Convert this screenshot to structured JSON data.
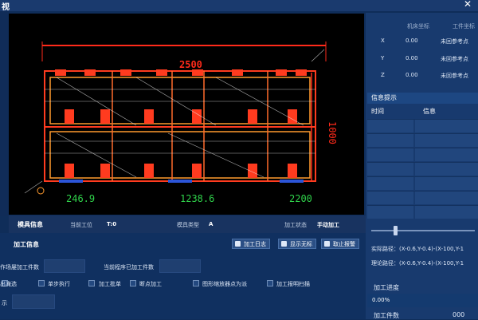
{
  "window": {
    "title": "视",
    "close_glyph": "✕"
  },
  "coords": {
    "col_machine": "机床坐标",
    "col_work": "工件坐标",
    "rows": [
      {
        "axis": "X",
        "machine": "0.00",
        "work": "未回参考点"
      },
      {
        "axis": "Y",
        "machine": "0.00",
        "work": "未回参考点"
      },
      {
        "axis": "Z",
        "machine": "0.00",
        "work": "未回参考点"
      }
    ]
  },
  "info_panel": {
    "header": "信息提示",
    "col_time": "时间",
    "col_info": "信息"
  },
  "trace": {
    "actual": "实际路径：(X-0.6,Y-0.4)-(X-100,Y-1",
    "theory": "理论路径：(X-0.6,Y-0.4)-(X-100,Y-1"
  },
  "progress": {
    "label": "加工进度",
    "value": "0.00%",
    "fraction": 0.0,
    "count_label": "加工件数",
    "count_value": "000"
  },
  "drawing": {
    "dim_top": "2500",
    "dim_right": "1000",
    "dim_bottom": [
      "246.9",
      "1238.6",
      "2200"
    ]
  },
  "status_strip": {
    "mold_info": "模具信息",
    "current_tool_label": "当前工位",
    "current_tool_value": "T:0",
    "mold_type_label": "模具类型",
    "mold_type_value": "A",
    "status_label": "加工状态",
    "status_value": "手动加工"
  },
  "processing": {
    "title": "加工信息",
    "btn_log": "加工日志",
    "btn_show": "显示无标",
    "btn_stop": "取止报警",
    "target_label": "作场屡加工件数",
    "done_label": "当前程序已加工件数",
    "checks": [
      "出淹选",
      "单步执行",
      "加工批单",
      "断点加工",
      "图形缩放器点为派",
      "加工报明扫描"
    ],
    "hint_label": "示"
  },
  "colors": {
    "drawing_red": "#ff3b1f",
    "drawing_orange": "#ff9a2e",
    "dim_green": "#2fd24a",
    "dim_red": "#ff2a1a"
  }
}
